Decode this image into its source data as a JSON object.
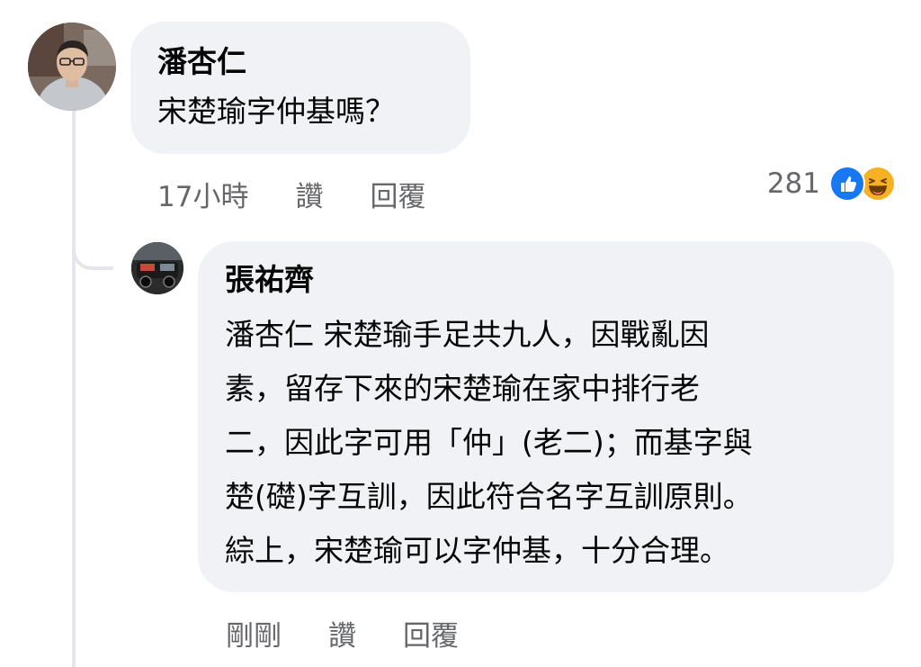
{
  "comments": [
    {
      "author": "潘杏仁",
      "text": "宋楚瑜字仲基嗎？",
      "timestamp": "17小時",
      "like_label": "讚",
      "reply_label": "回覆",
      "reaction_count": "281",
      "reaction_icons": [
        "like-icon",
        "haha-icon"
      ]
    },
    {
      "author": "張祐齊",
      "text_lines": [
        "潘杏仁 宋楚瑜手足共九人，因戰亂因",
        "素，留存下來的宋楚瑜在家中排行老",
        "二，因此字可用「仲」(老二)；而基字與",
        "楚(礎)字互訓，因此符合名字互訓原則。",
        "綜上，宋楚瑜可以字仲基，十分合理。"
      ],
      "timestamp": "剛剛",
      "like_label": "讚",
      "reply_label": "回覆"
    }
  ],
  "colors": {
    "bubble_bg": "#f0f2f5",
    "secondary_text": "#65676b",
    "like_blue": "#1877f2",
    "haha_yellow": "#f7b125",
    "thread_line": "#e4e6eb"
  }
}
